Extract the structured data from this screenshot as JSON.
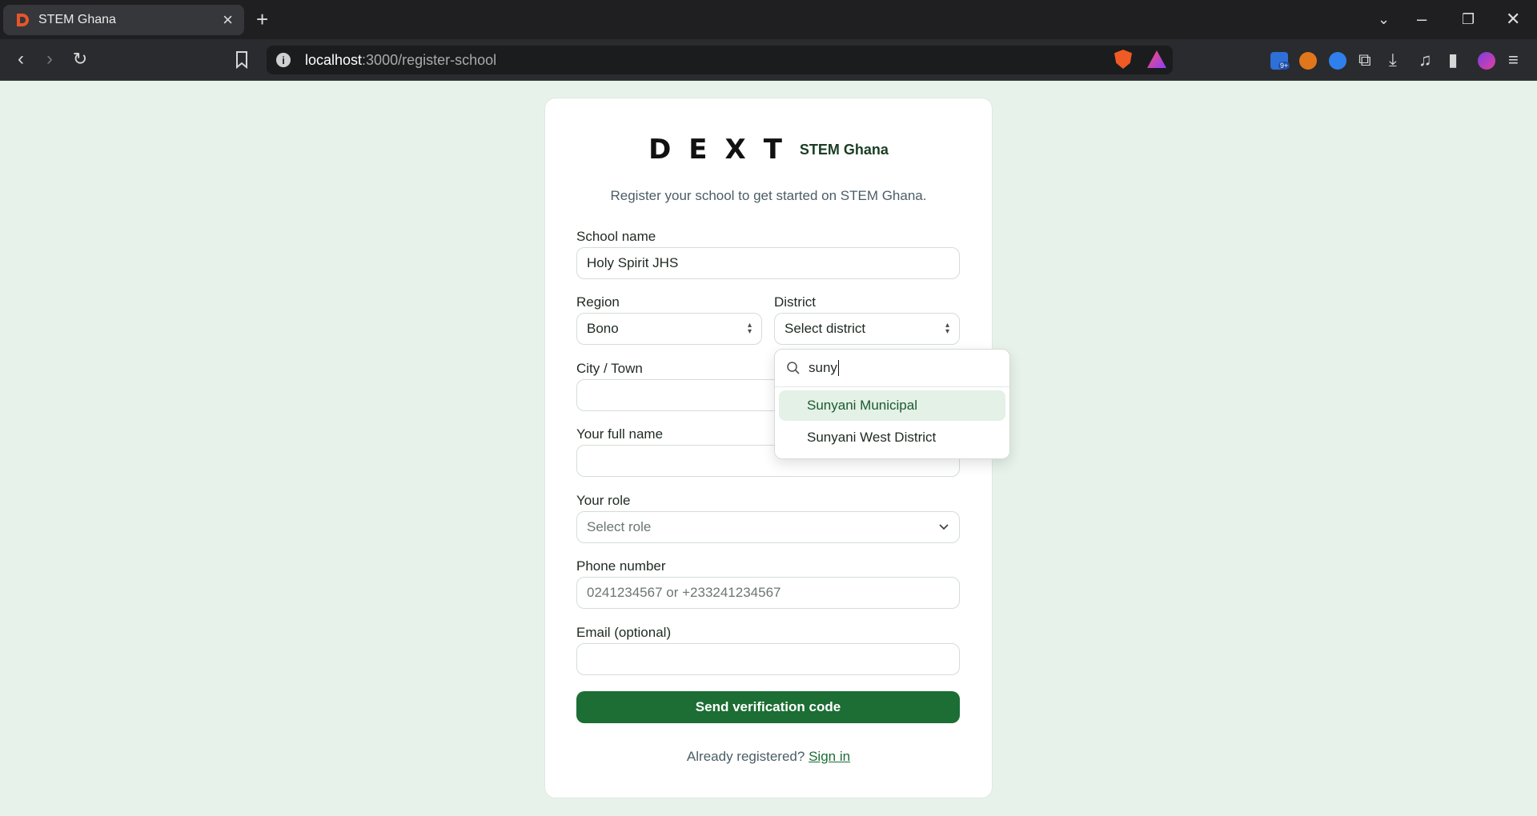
{
  "browser": {
    "tab_title": "STEM Ghana",
    "url_host": "localhost",
    "url_path": ":3000/register-school",
    "ext_badge": "9+"
  },
  "brand": {
    "logo_text": "DEXT",
    "name": "STEM Ghana",
    "accent": "#1c6e34"
  },
  "form": {
    "subtitle": "Register your school to get started on STEM Ghana.",
    "school_name_label": "School name",
    "school_name_value": "Holy Spirit JHS",
    "region_label": "Region",
    "region_value": "Bono",
    "district_label": "District",
    "district_placeholder": "Select district",
    "city_label": "City / Town",
    "city_value": "",
    "fullname_label": "Your full name",
    "fullname_value": "",
    "role_label": "Your role",
    "role_placeholder": "Select role",
    "phone_label": "Phone number",
    "phone_placeholder": "0241234567 or +233241234567",
    "email_label": "Email (optional)",
    "email_value": "",
    "submit_label": "Send verification code",
    "signin_prompt": "Already registered?",
    "signin_link": "Sign in"
  },
  "district_dropdown": {
    "search_value": "suny",
    "options": [
      "Sunyani Municipal",
      "Sunyani West District"
    ],
    "highlighted_index": 0
  }
}
